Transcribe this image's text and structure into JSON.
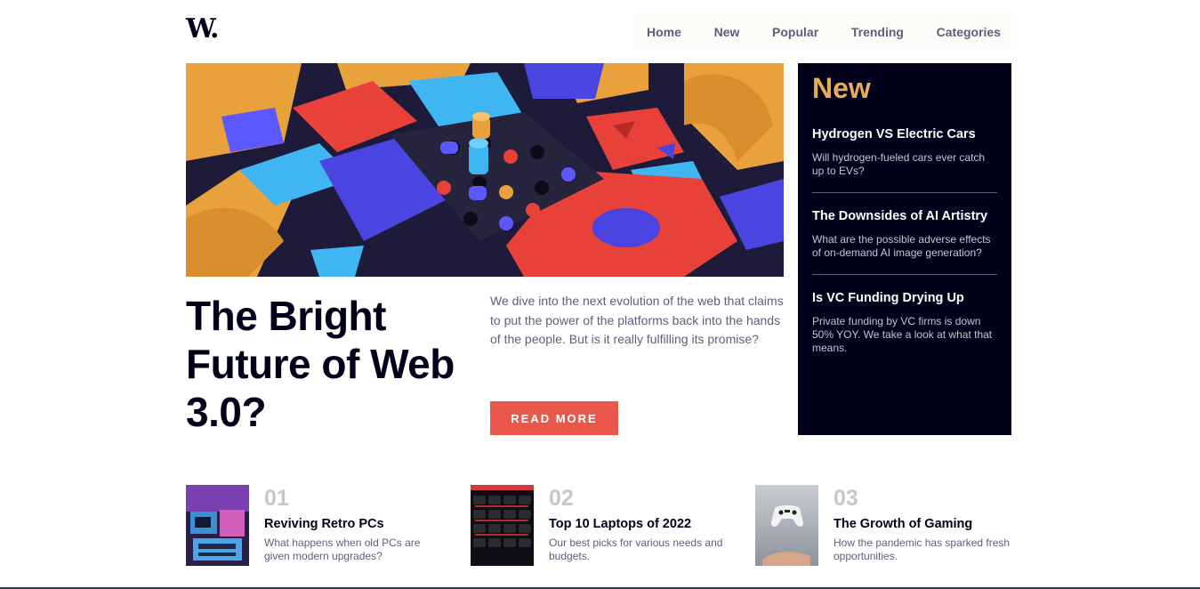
{
  "header": {
    "logo": "W.",
    "nav": [
      "Home",
      "New",
      "Popular",
      "Trending",
      "Categories"
    ]
  },
  "hero": {
    "title": "The Bright Future of Web 3.0?",
    "description": "We dive into the next evolution of the web that claims to put the power of the platforms back into the hands of the people. But is it really fulfilling its promise?",
    "button": "READ MORE"
  },
  "new_panel": {
    "heading": "New",
    "items": [
      {
        "title": "Hydrogen VS Electric Cars",
        "desc": "Will hydrogen-fueled cars ever catch up to EVs?"
      },
      {
        "title": "The Downsides of AI Artistry",
        "desc": "What are the possible adverse effects of on-demand AI image generation?"
      },
      {
        "title": "Is VC Funding Drying Up",
        "desc": "Private funding by VC firms is down 50% YOY. We take a look at what that means."
      }
    ]
  },
  "articles": [
    {
      "num": "01",
      "title": "Reviving Retro PCs",
      "desc": "What happens when old PCs are given modern upgrades?"
    },
    {
      "num": "02",
      "title": "Top 10 Laptops of 2022",
      "desc": "Our best picks for various needs and budgets."
    },
    {
      "num": "03",
      "title": "The Growth of Gaming",
      "desc": "How the pandemic has sparked fresh opportunities."
    }
  ],
  "colors": {
    "accent_orange": "#e9ab53",
    "accent_red": "#e9584a",
    "dark_blue": "#00001a",
    "grayish_blue": "#5d5f79",
    "light_gray": "#c5c6ce"
  }
}
